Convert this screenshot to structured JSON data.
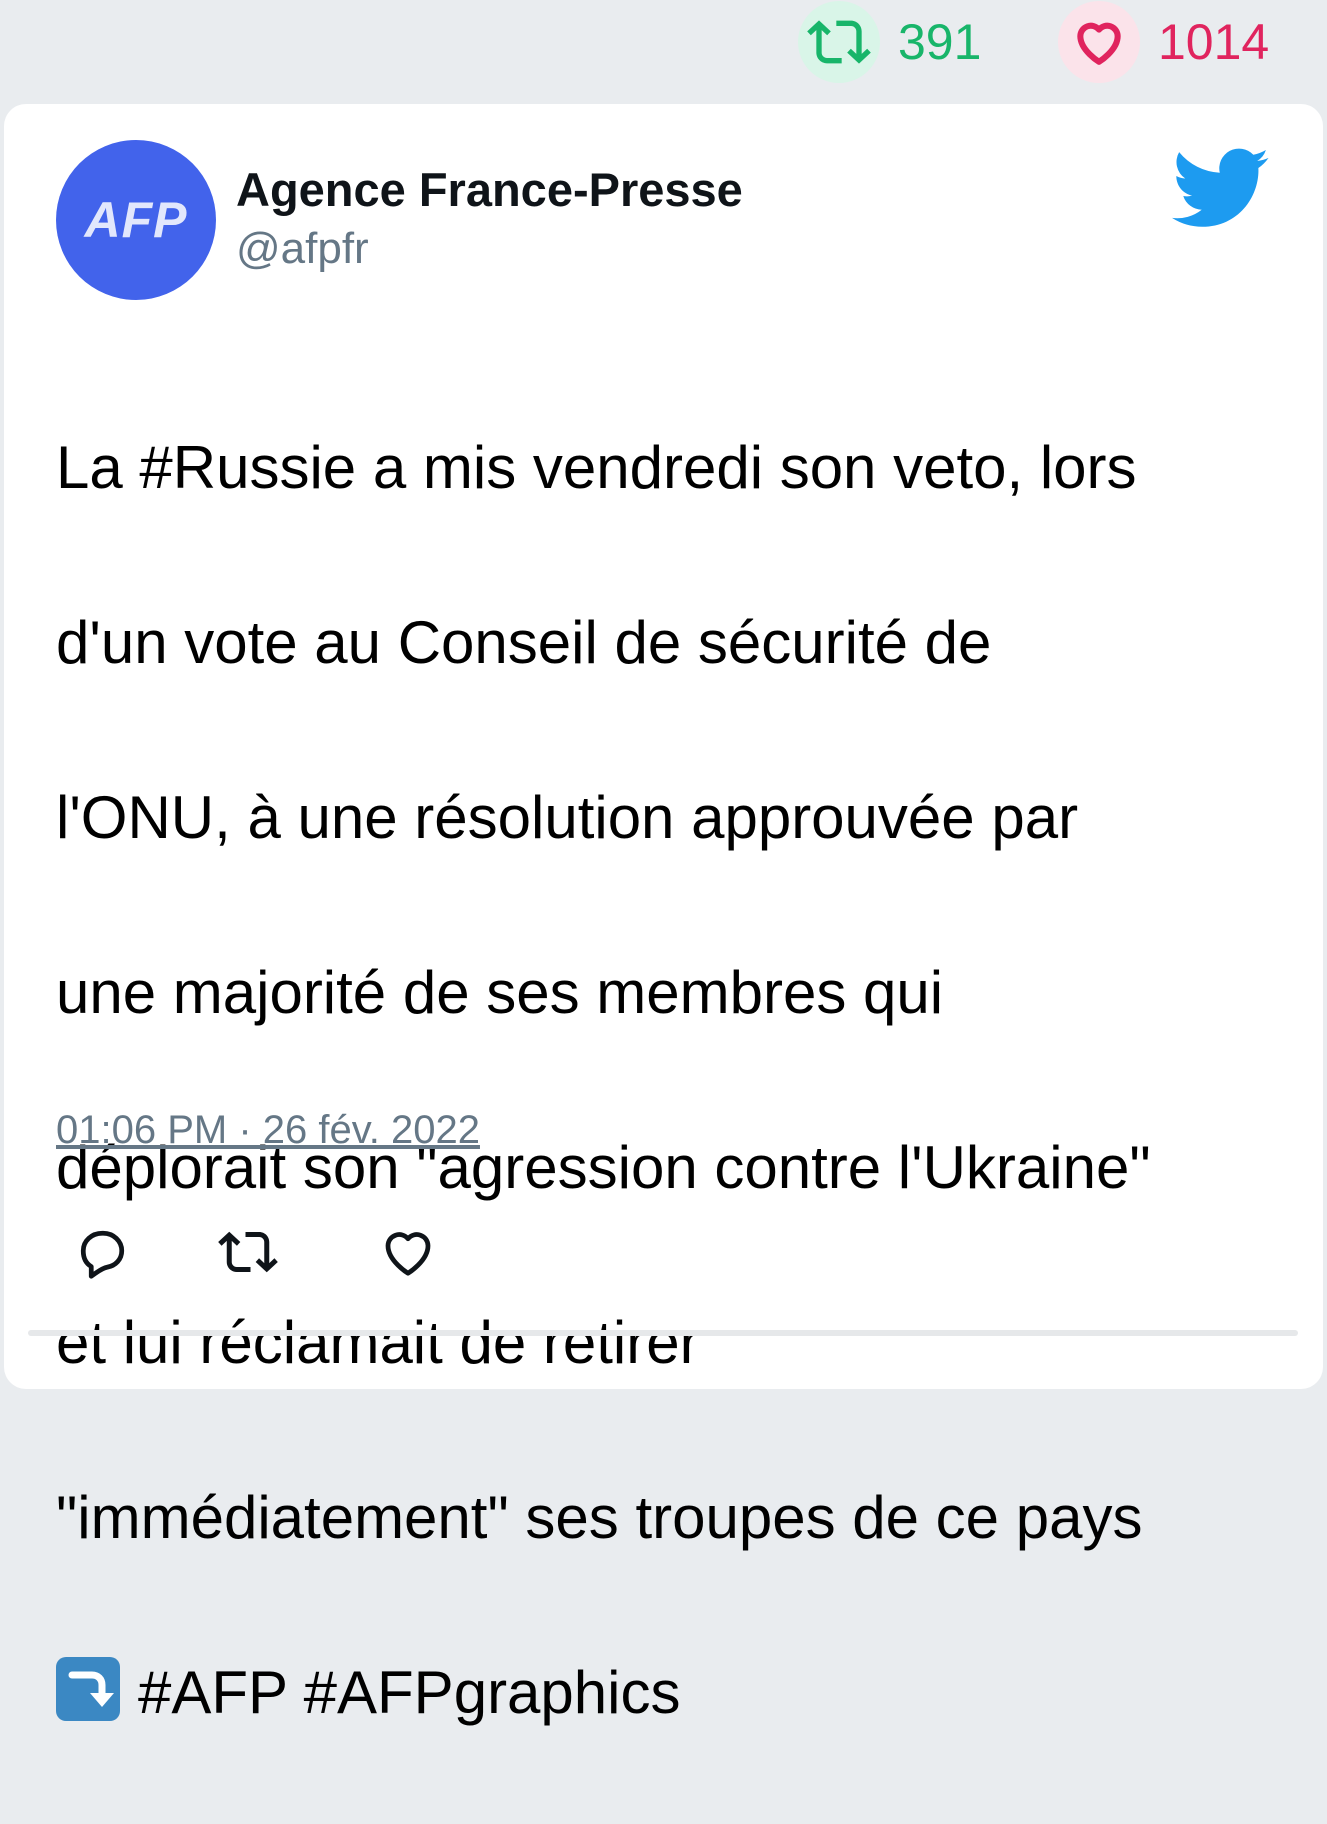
{
  "stats": {
    "retweets": "391",
    "likes": "1014"
  },
  "author": {
    "avatar_text": "AFP",
    "name": "Agence France-Presse",
    "handle": "@afpfr"
  },
  "tweet": {
    "lines": [
      "La #Russie a mis vendredi son veto, lors",
      "d'un vote au Conseil de sécurité de",
      "l'ONU, à une résolution approuvée par",
      "une majorité de ses membres qui",
      "déplorait son \"agression contre l'Ukraine\"",
      "et lui réclamait de retirer",
      "\"immédiatement\" ses troupes de ce pays"
    ],
    "last_line": "#AFP #AFPgraphics",
    "timestamp": "01:06 PM · 26 fév. 2022"
  },
  "colors": {
    "retweet_green": "#18b56a",
    "like_red": "#e0245e",
    "twitter_blue": "#1d9bf0",
    "avatar_blue": "#4263eb"
  },
  "icons": {
    "stat_retweet": "retweet-icon",
    "stat_like": "heart-icon",
    "brand": "twitter-bird-icon",
    "emoji": "arrow-down-right-emoji",
    "reply": "reply-icon",
    "retweet": "retweet-icon",
    "like": "heart-icon"
  }
}
